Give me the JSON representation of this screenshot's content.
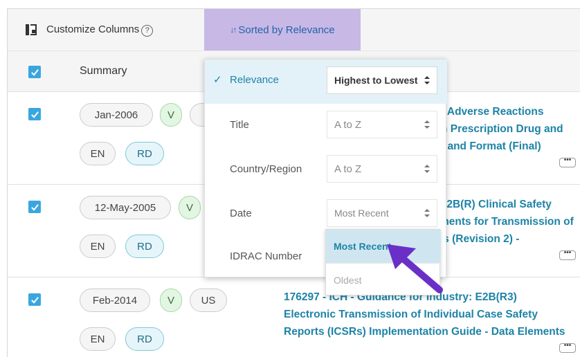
{
  "toolbar": {
    "customize_label": "Customize Columns",
    "help_glyph": "?",
    "sort_label": "Sorted by Relevance",
    "sort_icon_glyph": "↓↑"
  },
  "table": {
    "summary_header": "Summary",
    "rows": [
      {
        "date": "Jan-2006",
        "version_badge": "V",
        "lang": "EN",
        "type": "RD",
        "title_lines": [
          ": Adverse Reactions",
          "n Prescription Drug and",
          "t and Format (Final)"
        ]
      },
      {
        "date": "12-May-2005",
        "version_badge": "V",
        "lang": "EN",
        "type": "RD",
        "title_lines": [
          "E2B(R) Clinical Safety",
          "ments for Transmission of",
          "ts (Revision 2) -"
        ]
      },
      {
        "date": "Feb-2014",
        "version_badge": "V",
        "country": "US",
        "lang": "EN",
        "type": "RD",
        "title_lines": [
          "176297 - ICH - Guidance for Industry: E2B(R3)",
          "Electronic Transmission of Individual Case Safety",
          "Reports (ICSRs) Implementation Guide - Data Elements"
        ]
      }
    ],
    "more_glyph": "•••"
  },
  "sort_menu": {
    "check_glyph": "✓",
    "items": [
      {
        "label": "Relevance",
        "value": "Highest to Lowest",
        "active": true
      },
      {
        "label": "Title",
        "value": "A to Z"
      },
      {
        "label": "Country/Region",
        "value": "A to Z"
      },
      {
        "label": "Date",
        "value": "Most Recent"
      },
      {
        "label": "IDRAC Number",
        "value": ""
      }
    ],
    "date_options": [
      "Most Recent",
      "Oldest"
    ]
  },
  "colors": {
    "accent": "#1d83a6",
    "sort_tab_bg": "#c7b8e6",
    "checkbox": "#3aa6e0",
    "arrow": "#6a2fc7"
  }
}
